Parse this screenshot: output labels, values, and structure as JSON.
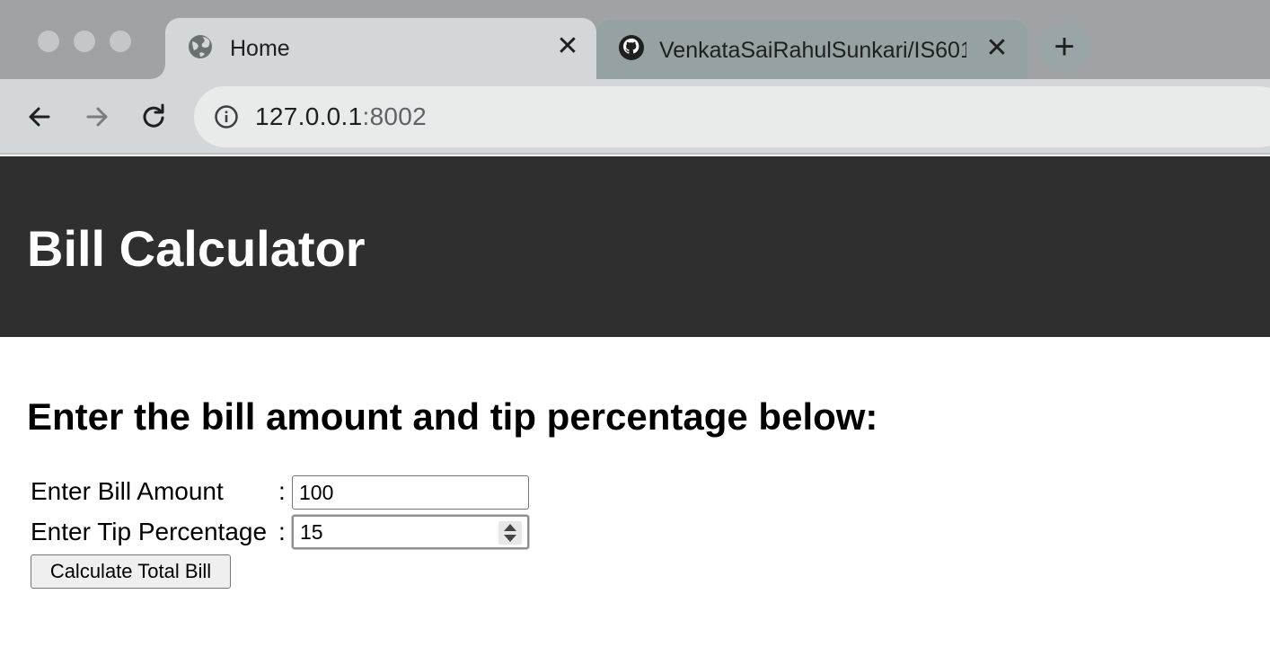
{
  "browser": {
    "tabs": [
      {
        "title": "Home",
        "icon": "globe-icon",
        "active": true
      },
      {
        "title": "VenkataSaiRahulSunkari/IS601",
        "icon": "github-icon",
        "active": false
      }
    ],
    "close_glyph": "✕",
    "new_tab_glyph": "+",
    "url_host": "127.0.0.1",
    "url_port": ":8002"
  },
  "page": {
    "title": "Bill Calculator",
    "subheading": "Enter the bill amount and tip percentage below:",
    "form": {
      "bill_label": "Enter Bill Amount",
      "bill_colon": ":",
      "bill_value": "100",
      "tip_label": "Enter Tip Percentage",
      "tip_colon": ":",
      "tip_value": "15",
      "submit_label": "Calculate Total Bill"
    }
  },
  "colors": {
    "header_bg": "#2f2f2f",
    "tabstrip_bg": "#a0a3a5",
    "toolbar_bg": "#d3d7d9"
  }
}
